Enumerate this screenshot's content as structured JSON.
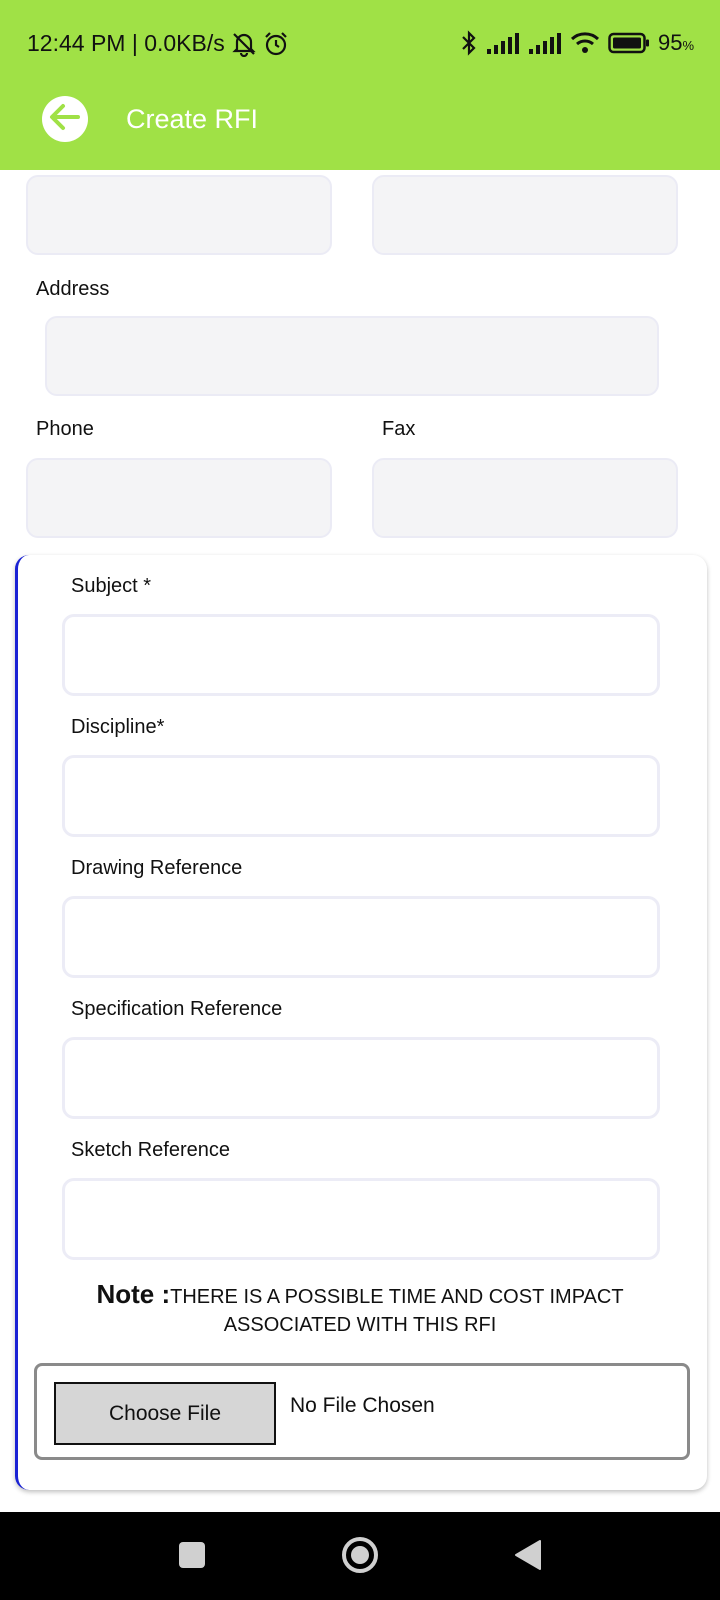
{
  "status_bar": {
    "time_network": "12:44 PM | 0.0KB/s",
    "battery": "95",
    "battery_unit": "%"
  },
  "app_bar": {
    "title": "Create RFI"
  },
  "contact": {
    "address_label": "Address",
    "phone_label": "Phone",
    "fax_label": "Fax"
  },
  "rfi": {
    "subject_label": "Subject *",
    "discipline_label": "Discipline*",
    "drawing_label": "Drawing Reference",
    "specification_label": "Specification Reference",
    "sketch_label": "Sketch Reference",
    "note_prefix": "Note :",
    "note_text": "THERE IS A POSSIBLE TIME AND COST IMPACT ASSOCIATED WITH THIS RFI",
    "choose_file_label": "Choose File",
    "file_status": "No File Chosen"
  },
  "colors": {
    "app_bar": "#a0e146",
    "card_accent": "#1a22d4",
    "field_fill": "#f4f4f6"
  },
  "icons": {
    "back": "arrow-left-icon",
    "status": [
      "muted-bell-icon",
      "alarm-icon",
      "bluetooth-icon",
      "signal-icon",
      "signal-icon",
      "wifi-icon",
      "battery-icon"
    ],
    "nav": [
      "square-recents-icon",
      "circle-home-icon",
      "triangle-back-icon"
    ]
  }
}
